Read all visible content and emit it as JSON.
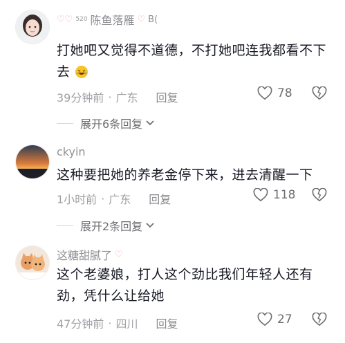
{
  "comments": [
    {
      "username": "陈鱼落雁",
      "username_prefix": "520",
      "username_suffix": "B(",
      "text": "打她吧又觉得不道德，不打她吧连我都看不下去",
      "time": "39分钟前",
      "location": "广东",
      "reply": "回复",
      "likes": "78",
      "expand": "展开6条回复"
    },
    {
      "username": "ckyin",
      "text": "这种要把她的养老金停下来，进去清醒一下",
      "time": "1小时前",
      "location": "广东",
      "reply": "回复",
      "likes": "118",
      "expand": "展开2条回复"
    },
    {
      "username": "这糖甜腻了",
      "text": "这个老婆娘，打人这个劲比我们年轻人还有劲，凭什么让给她",
      "time": "47分钟前",
      "location": "四川",
      "reply": "回复",
      "likes": "27"
    }
  ],
  "separator": "·",
  "colors": {
    "text": "#161823",
    "muted": "#a0a0a5",
    "accent_pink": "#f0a3b5"
  }
}
